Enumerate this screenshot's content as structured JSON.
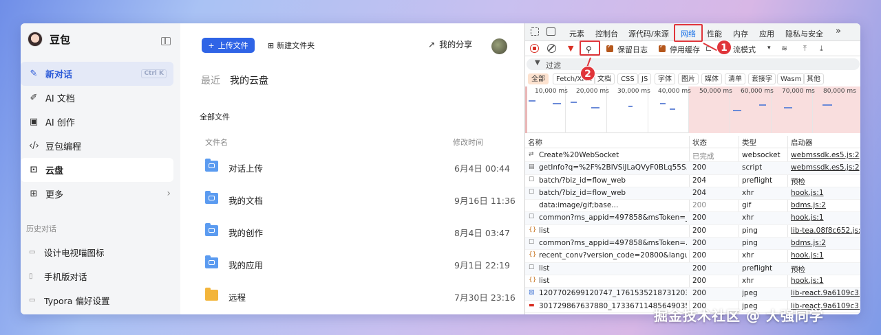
{
  "sidebar": {
    "brand_name": "豆包",
    "nav": [
      {
        "label": "新对话",
        "icon": "new-chat-icon",
        "shortcut": "Ctrl K"
      },
      {
        "label": "AI 文档",
        "icon": "pen-icon"
      },
      {
        "label": "AI 创作",
        "icon": "image-icon"
      },
      {
        "label": "豆包编程",
        "icon": "code-icon"
      },
      {
        "label": "云盘",
        "icon": "cloud-disk-icon"
      },
      {
        "label": "更多",
        "icon": "grid-icon"
      }
    ],
    "history_title": "历史对话",
    "history": [
      {
        "label": "设计电视喵图标"
      },
      {
        "label": "手机版对话"
      },
      {
        "label": "Typora 偏好设置"
      }
    ]
  },
  "main": {
    "upload_label": "上传文件",
    "new_folder_label": "新建文件夹",
    "share_label": "我的分享",
    "breadcrumb_recent": "最近",
    "breadcrumb_current": "我的云盘",
    "all_files_label": "全部文件",
    "col_name": "文件名",
    "col_time": "修改时间",
    "files": [
      {
        "name": "对话上传",
        "time": "6月4日 00:44"
      },
      {
        "name": "我的文档",
        "time": "9月16日 11:36"
      },
      {
        "name": "我的创作",
        "time": "8月4日 03:47"
      },
      {
        "name": "我的应用",
        "time": "9月1日 22:19"
      },
      {
        "name": "远程",
        "time": "7月30日 23:16"
      }
    ]
  },
  "devtools": {
    "tabs": [
      "元素",
      "控制台",
      "源代码/来源",
      "网络",
      "性能",
      "内存",
      "应用",
      "隐私与安全"
    ],
    "more_tabs": "»",
    "preserve_log": "保留日志",
    "disable_cache": "停用缓存",
    "throttle": "流模式",
    "filter_placeholder": "过滤",
    "types": [
      "全部",
      "Fetch/XHR",
      "文档",
      "CSS",
      "JS",
      "字体",
      "图片",
      "媒体",
      "清单",
      "套接字",
      "Wasm",
      "其他"
    ],
    "ticks": [
      "10,000 ms",
      "20,000 ms",
      "30,000 ms",
      "40,000 ms",
      "50,000 ms",
      "60,000 ms",
      "70,000 ms",
      "80,000 ms"
    ],
    "columns": {
      "name": "名称",
      "status": "状态",
      "type": "类型",
      "initiator": "启动器"
    },
    "requests": [
      {
        "icon": "⇄",
        "name": "Create%20WebSocket",
        "status": "已完成",
        "type": "websocket",
        "initiator": "webmssdk.es5.js:2"
      },
      {
        "icon": "▤",
        "name": "getInfo?q=%2F%2BlVSiJLaQVyF0BLq55S...",
        "status": "200",
        "type": "script",
        "initiator": "webmssdk.es5.js:2"
      },
      {
        "icon": "☐",
        "name": "batch/?biz_id=flow_web",
        "status": "204",
        "type": "preflight",
        "initiator": "预检"
      },
      {
        "icon": "☐",
        "name": "batch/?biz_id=flow_web",
        "status": "204",
        "type": "xhr",
        "initiator": "hook.js:1"
      },
      {
        "icon": "",
        "name": "data:image/gif;base...",
        "status": "200",
        "type": "gif",
        "initiator": "bdms.js:2"
      },
      {
        "icon": "☐",
        "name": "common?ms_appid=497858&msToken=_...",
        "status": "200",
        "type": "xhr",
        "initiator": "hook.js:1"
      },
      {
        "icon": "{}",
        "name": "list",
        "status": "200",
        "type": "ping",
        "initiator": "lib-tea.08f8c652.js:1"
      },
      {
        "icon": "☐",
        "name": "common?ms_appid=497858&msToken=...",
        "status": "200",
        "type": "ping",
        "initiator": "bdms.js:2"
      },
      {
        "icon": "{}",
        "name": "recent_conv?version_code=20800&langu...",
        "status": "200",
        "type": "xhr",
        "initiator": "hook.js:1"
      },
      {
        "icon": "☐",
        "name": "list",
        "status": "200",
        "type": "preflight",
        "initiator": "预检"
      },
      {
        "icon": "{}",
        "name": "list",
        "status": "200",
        "type": "xhr",
        "initiator": "hook.js:1"
      },
      {
        "icon": "▨",
        "name": "1207702699120747_17615352187312036...",
        "status": "200",
        "type": "jpeg",
        "initiator": "lib-react.9a6109c3.js"
      },
      {
        "icon": "▬",
        "name": "301729867637880_17336711485649035...",
        "status": "200",
        "type": "jpeg",
        "initiator": "lib-react.9a6109c3.js"
      }
    ]
  },
  "annotations": {
    "badge1": "1",
    "badge2": "2",
    "accent": "#e0353a"
  },
  "watermark": "掘金技术社区 @ 大强同学"
}
